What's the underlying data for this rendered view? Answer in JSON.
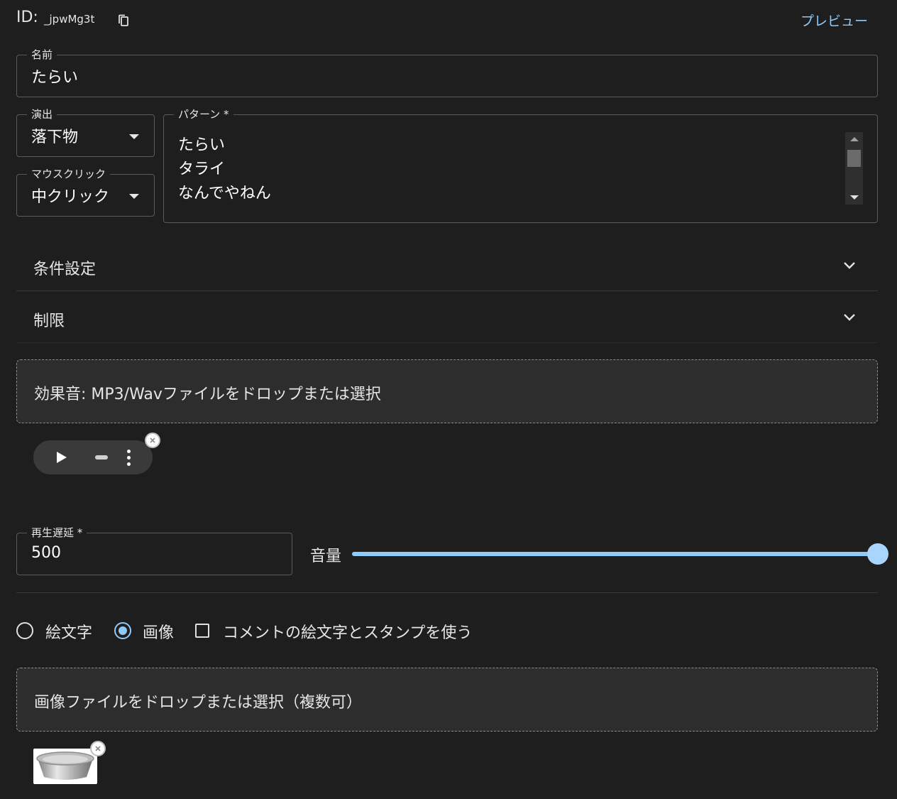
{
  "header": {
    "id_label": "ID:",
    "id_value": "_jpwMg3t",
    "preview_label": "プレビュー"
  },
  "name_field": {
    "label": "名前",
    "value": "たらい"
  },
  "effect_select": {
    "label": "演出",
    "value": "落下物"
  },
  "mouse_select": {
    "label": "マウスクリック",
    "value": "中クリック"
  },
  "pattern_field": {
    "label": "パターン *",
    "lines": [
      "たらい",
      "タライ",
      "なんでやねん"
    ]
  },
  "accordions": [
    {
      "title": "条件設定"
    },
    {
      "title": "制限"
    }
  ],
  "sound_drop": {
    "text": "効果音: MP3/Wavファイルをドロップまたは選択"
  },
  "delay_field": {
    "label": "再生遅延 *",
    "value": "500"
  },
  "volume": {
    "label": "音量",
    "value": 1.0
  },
  "options": {
    "emoji_label": "絵文字",
    "image_label": "画像",
    "comment_label": "コメントの絵文字とスタンプを使う",
    "selected": "画像",
    "comment_checked": false
  },
  "image_drop": {
    "text": "画像ファイルをドロップまたは選択（複数可）"
  },
  "colors": {
    "accent": "#90caf9",
    "background": "#1e1e1e",
    "dropzone": "#2d2d2d"
  }
}
